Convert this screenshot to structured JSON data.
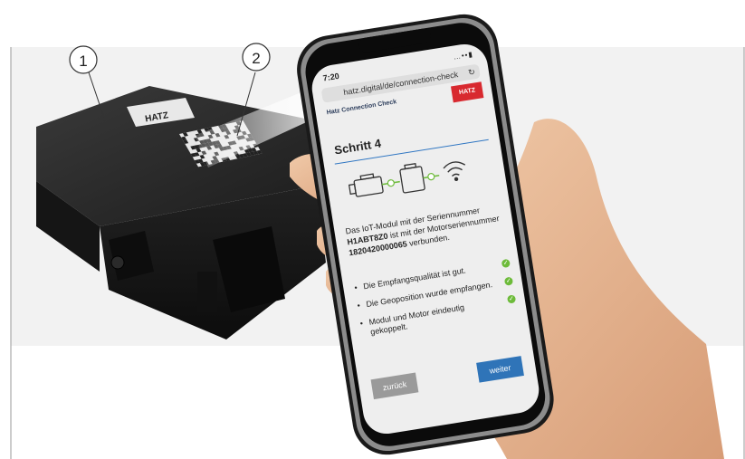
{
  "callouts": [
    "1",
    "2"
  ],
  "device": {
    "logo": "HATZ"
  },
  "phone": {
    "status_time": "7:20",
    "status_icons": "…••▮",
    "url": "hatz.digital/de/connection-check",
    "reload_icon": "reload-icon",
    "app_title": "Hatz Connection Check",
    "brand_badge": "HATZ",
    "step_title": "Schritt 4",
    "description_prefix": "Das IoT-Modul mit der Seriennummer",
    "module_serial": "H1ABT8Z0",
    "description_mid": "ist mit der Motorseriennummer",
    "motor_serial": "1820420000065",
    "description_suffix": "verbunden.",
    "checks": [
      "Die Empfangsqualität ist gut.",
      "Die Geoposition wurde empfangen.",
      "Modul und Motor eindeutig gekoppelt."
    ],
    "back_label": "zurück",
    "next_label": "weiter",
    "colors": {
      "accent_blue": "#2f74b8",
      "brand_red": "#d8292f",
      "check_green": "#6dbb3a"
    }
  }
}
